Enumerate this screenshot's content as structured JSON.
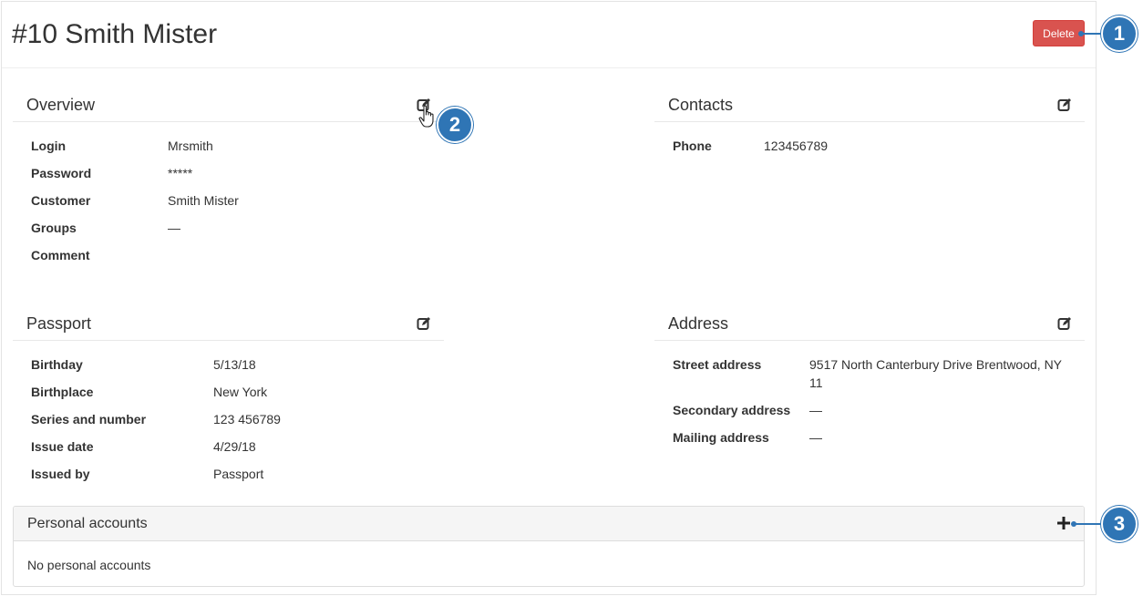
{
  "header": {
    "title": "#10 Smith Mister",
    "delete_label": "Delete"
  },
  "overview": {
    "title": "Overview",
    "fields": [
      {
        "label": "Login",
        "value": "Mrsmith"
      },
      {
        "label": "Password",
        "value": "*****"
      },
      {
        "label": "Customer",
        "value": "Smith Mister"
      },
      {
        "label": "Groups",
        "value": "—"
      },
      {
        "label": "Comment",
        "value": ""
      }
    ]
  },
  "contacts": {
    "title": "Contacts",
    "fields": [
      {
        "label": "Phone",
        "value": "123456789"
      }
    ]
  },
  "passport": {
    "title": "Passport",
    "fields": [
      {
        "label": "Birthday",
        "value": "5/13/18"
      },
      {
        "label": "Birthplace",
        "value": "New York"
      },
      {
        "label": "Series and number",
        "value": "123 456789"
      },
      {
        "label": "Issue date",
        "value": "4/29/18"
      },
      {
        "label": "Issued by",
        "value": "Passport"
      }
    ]
  },
  "address": {
    "title": "Address",
    "fields": [
      {
        "label": "Street address",
        "value": "9517 North Canterbury Drive Brentwood, NY",
        "value2": "11"
      },
      {
        "label": "Secondary address",
        "value": "—"
      },
      {
        "label": "Mailing address",
        "value": "—"
      }
    ]
  },
  "accounts": {
    "title": "Personal accounts",
    "empty_text": "No personal accounts"
  },
  "callouts": [
    "1",
    "2",
    "3"
  ],
  "icons": {
    "edit": "edit-icon",
    "plus": "plus-icon",
    "cursor": "hand-cursor-icon"
  },
  "colors": {
    "delete": "#d9534f",
    "callout": "#2f75b5"
  }
}
